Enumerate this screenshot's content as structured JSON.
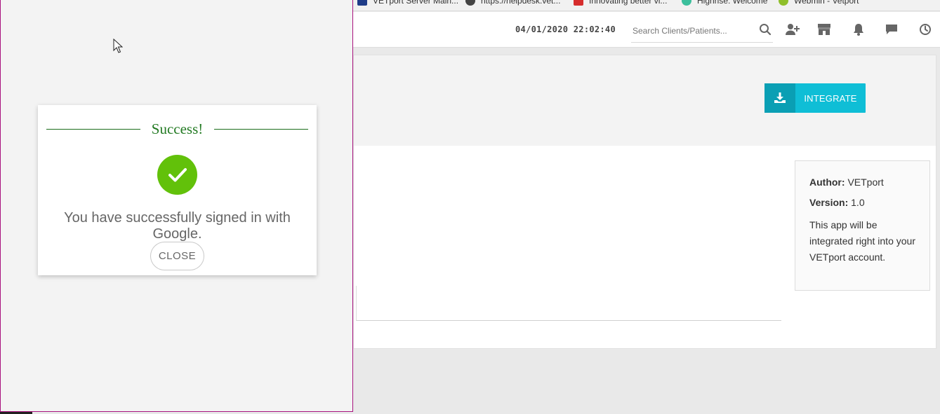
{
  "bookmarks": [
    {
      "label": "VETport Server Main...",
      "icon": "vetport-favicon",
      "color": "#1f3c88"
    },
    {
      "label": "https://helpdesk.vet...",
      "icon": "github-favicon",
      "color": "#444444"
    },
    {
      "label": "Innovating better vi...",
      "icon": "x-favicon",
      "color": "#d62d2d"
    },
    {
      "label": "Highrise: Welcome",
      "icon": "highrise-favicon",
      "color": "#3cbf9c"
    },
    {
      "label": "Webmin - Vetport",
      "icon": "webmin-favicon",
      "color": "#8fbf2a"
    }
  ],
  "header": {
    "datetime": "04/01/2020 22:02:40",
    "search_placeholder": "Search Clients/Patients...",
    "icons": [
      "search-icon",
      "add-user-icon",
      "store-icon",
      "bell-icon",
      "chat-icon",
      "clock-icon"
    ]
  },
  "app": {
    "integrate_label": "INTEGRATE",
    "author_label": "Author:",
    "author_value": "VETport",
    "version_label": "Version:",
    "version_value": "1.0",
    "description": "This app will be integrated right into your VETport account."
  },
  "modal": {
    "title": "Success!",
    "message": "You have successfully signed in with Google.",
    "close_label": "CLOSE",
    "accent_color": "#62c10a",
    "title_color": "#237a23"
  }
}
